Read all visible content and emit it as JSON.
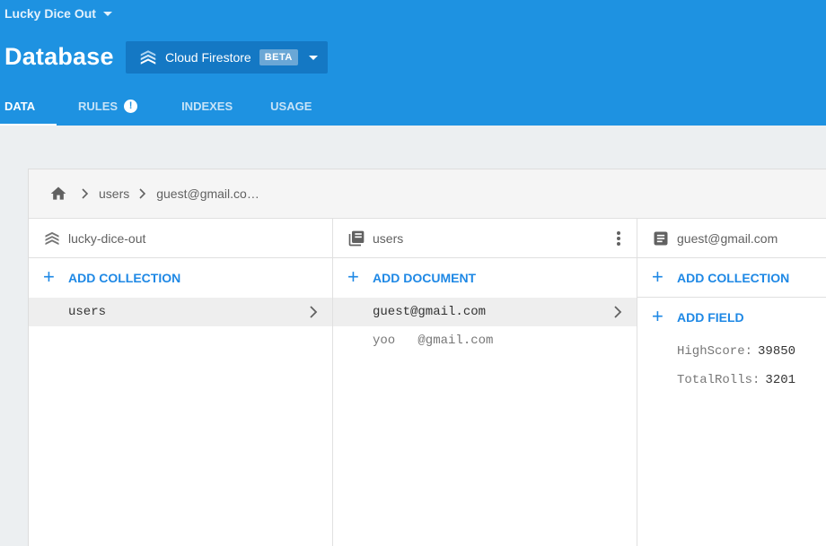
{
  "project": {
    "name": "Lucky Dice Out"
  },
  "page": {
    "title": "Database"
  },
  "product": {
    "name": "Cloud Firestore",
    "badge": "BETA"
  },
  "tabs": [
    {
      "label": "DATA",
      "active": true
    },
    {
      "label": "RULES",
      "active": false,
      "badge": "!"
    },
    {
      "label": "INDEXES",
      "active": false
    },
    {
      "label": "USAGE",
      "active": false
    }
  ],
  "breadcrumb": {
    "items": [
      "users",
      "guest@gmail.co…"
    ]
  },
  "columns": {
    "root": {
      "title": "lucky-dice-out",
      "action": "ADD COLLECTION",
      "items": [
        {
          "label": "users",
          "selected": true
        }
      ]
    },
    "collection": {
      "title": "users",
      "action": "ADD DOCUMENT",
      "items": [
        {
          "label": "guest@gmail.com",
          "selected": true
        },
        {
          "label": "yoo   @gmail.com",
          "selected": false
        }
      ]
    },
    "document": {
      "title": "guest@gmail.com",
      "action_collection": "ADD COLLECTION",
      "action_field": "ADD FIELD",
      "fields": [
        {
          "key": "HighScore:",
          "value": "39850"
        },
        {
          "key": "TotalRolls:",
          "value": "3201"
        }
      ]
    }
  },
  "colors": {
    "header": "#1e92e1",
    "accent": "#1e88e5",
    "product_bg": "#1478c4"
  },
  "icons": [
    "chevron-down-icon",
    "firestore-icon",
    "home-icon",
    "chevron-right-icon",
    "collection-icon",
    "document-icon",
    "more-vert-icon",
    "add-icon",
    "alert-icon"
  ]
}
